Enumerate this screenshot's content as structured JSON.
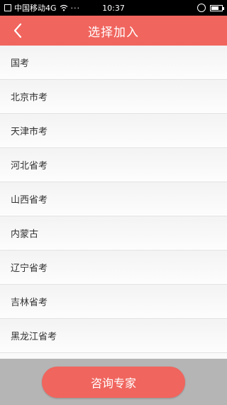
{
  "status_bar": {
    "carrier": "中国移动4G",
    "extra": "···",
    "time": "10:37",
    "battery_level": 0.7
  },
  "header": {
    "title": "选择加入",
    "back_icon": "chevron-left-icon",
    "color": "#f0655e"
  },
  "list": {
    "items": [
      {
        "label": "国考"
      },
      {
        "label": "北京市考"
      },
      {
        "label": "天津市考"
      },
      {
        "label": "河北省考"
      },
      {
        "label": "山西省考"
      },
      {
        "label": "内蒙古"
      },
      {
        "label": "辽宁省考"
      },
      {
        "label": "吉林省考"
      },
      {
        "label": "黑龙江省考"
      }
    ]
  },
  "footer": {
    "consult_label": "咨询专家"
  }
}
